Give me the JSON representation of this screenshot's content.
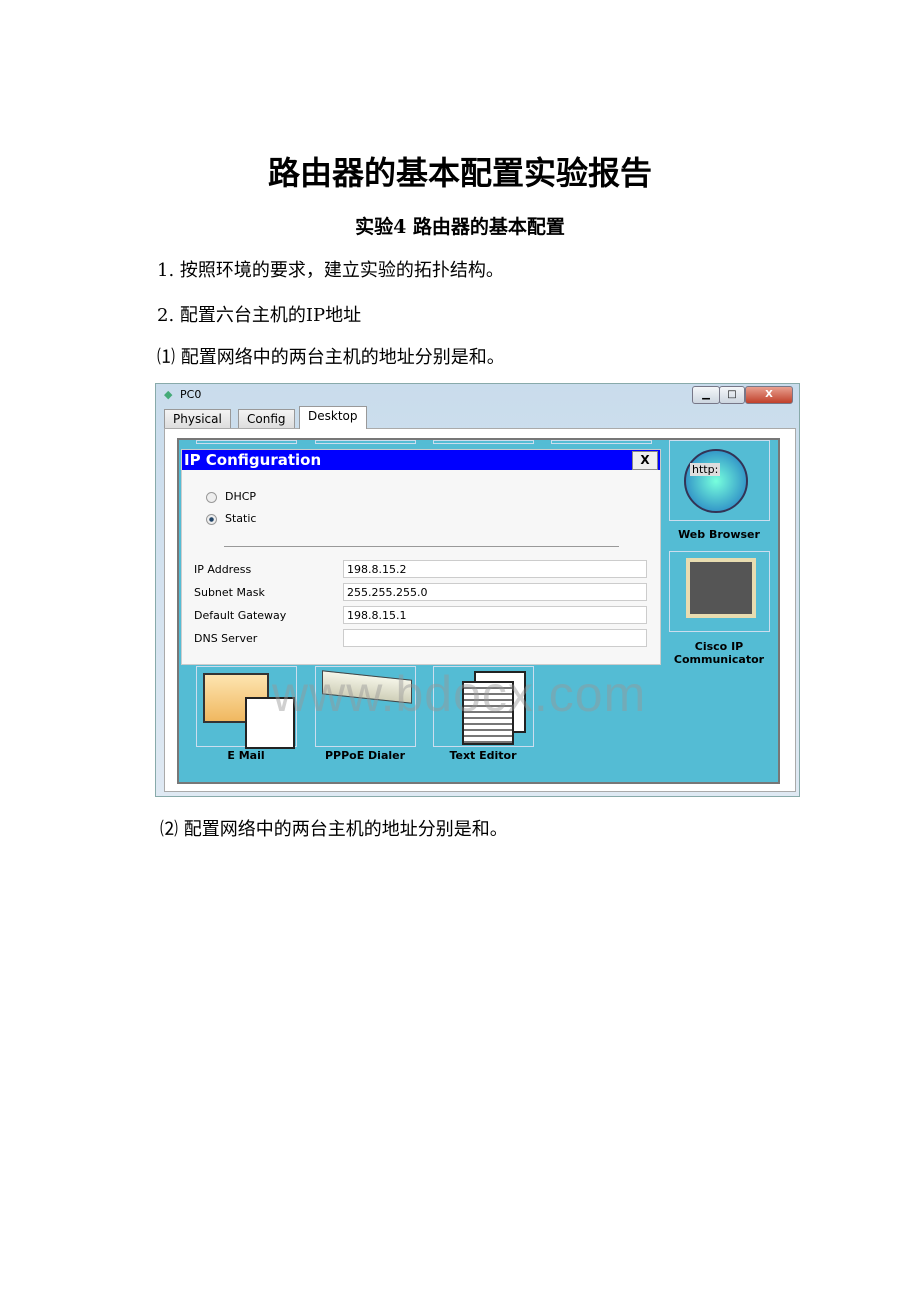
{
  "title": "路由器的基本配置实验报告",
  "subtitle": "实验4  路由器的基本配置",
  "paragraphs": [
    "1. 按照环境的要求，建立实验的拓扑结构。",
    "2. 配置六台主机的IP地址",
    "⑴ 配置网络中的两台主机的地址分别是和。",
    "⑵ 配置网络中的两台主机的地址分别是和。"
  ],
  "window": {
    "title": "PC0",
    "controls": {
      "minimize": "▁",
      "maximize": "□",
      "close": "X"
    },
    "tabs": [
      {
        "label": "Physical"
      },
      {
        "label": "Config"
      },
      {
        "label": "Desktop",
        "active": true
      }
    ],
    "dialog": {
      "title": "IP Configuration",
      "close": "X",
      "modes": [
        {
          "label": "DHCP",
          "selected": false
        },
        {
          "label": "Static",
          "selected": true
        }
      ],
      "fields": [
        {
          "label": "IP Address",
          "value": "198.8.15.2"
        },
        {
          "label": "Subnet Mask",
          "value": "255.255.255.0"
        },
        {
          "label": "Default Gateway",
          "value": "198.8.15.1"
        },
        {
          "label": "DNS Server",
          "value": ""
        }
      ]
    },
    "apps": [
      {
        "label": "Web Browser",
        "icon": "web-browser-icon"
      },
      {
        "label": "Cisco IP Communicator",
        "icon": "ip-communicator-icon"
      },
      {
        "label": "E Mail",
        "icon": "email-icon"
      },
      {
        "label": "PPPoE Dialer",
        "icon": "pppoe-dialer-icon"
      },
      {
        "label": "Text Editor",
        "icon": "text-editor-icon"
      }
    ],
    "desktop_color": "#54bcd4",
    "dialog_header_color": "#0000ff"
  },
  "watermark": "www.bdocx.com"
}
